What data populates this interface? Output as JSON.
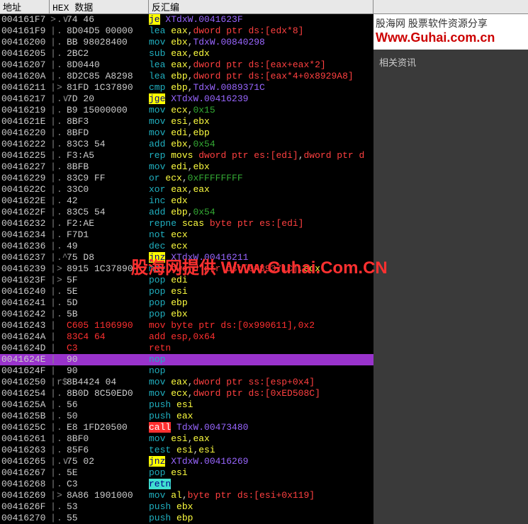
{
  "headers": {
    "addr": "地址",
    "hex": "HEX 数据",
    "disasm": "反汇编"
  },
  "sidebar": {
    "logo_top": "股海网 股票软件资源分享",
    "logo_bot": "Www.Guhai.com.cn",
    "title": "相关资讯"
  },
  "watermark": "股海网提供 Www.Guhai.Com.CN",
  "rows": [
    {
      "addr": "004161F7",
      "pipe": ">",
      "dot": ".∨",
      "hex": "74 46",
      "d": [
        {
          "t": "je",
          "c": "yellow"
        },
        {
          "t": " "
        },
        {
          "t": "XTdxW.0041623F",
          "c": "sym"
        }
      ]
    },
    {
      "addr": "004161F9",
      "pipe": "|",
      "dot": ".",
      "hex": "8D04D5 00000",
      "d": [
        {
          "t": "lea",
          "c": "mn"
        },
        {
          "t": " "
        },
        {
          "t": "eax",
          "c": "reg"
        },
        {
          "t": ",",
          "c": "punc"
        },
        {
          "t": "dword ptr ds:[edx*8]",
          "c": "mem"
        }
      ]
    },
    {
      "addr": "00416200",
      "pipe": "|",
      "dot": ".",
      "hex": "BB 98028400",
      "d": [
        {
          "t": "mov",
          "c": "mn"
        },
        {
          "t": " "
        },
        {
          "t": "ebx",
          "c": "reg"
        },
        {
          "t": ",",
          "c": "punc"
        },
        {
          "t": "TdxW.00840298",
          "c": "sym"
        }
      ]
    },
    {
      "addr": "00416205",
      "pipe": "|",
      "dot": ".",
      "hex": "2BC2",
      "d": [
        {
          "t": "sub",
          "c": "mn"
        },
        {
          "t": " "
        },
        {
          "t": "eax",
          "c": "reg"
        },
        {
          "t": ",",
          "c": "punc"
        },
        {
          "t": "edx",
          "c": "reg"
        }
      ]
    },
    {
      "addr": "00416207",
      "pipe": "|",
      "dot": ".",
      "hex": "8D0440",
      "d": [
        {
          "t": "lea",
          "c": "mn"
        },
        {
          "t": " "
        },
        {
          "t": "eax",
          "c": "reg"
        },
        {
          "t": ",",
          "c": "punc"
        },
        {
          "t": "dword ptr ds:[eax+eax*2]",
          "c": "mem"
        }
      ]
    },
    {
      "addr": "0041620A",
      "pipe": "|",
      "dot": ".",
      "hex": "8D2C85 A8298",
      "d": [
        {
          "t": "lea",
          "c": "mn"
        },
        {
          "t": " "
        },
        {
          "t": "ebp",
          "c": "reg"
        },
        {
          "t": ",",
          "c": "punc"
        },
        {
          "t": "dword ptr ds:[eax*4+0x8929A8]",
          "c": "mem"
        }
      ]
    },
    {
      "addr": "00416211",
      "pipe": "|",
      "dot": ">",
      "hex": "81FD 1C37890",
      "d": [
        {
          "t": "cmp",
          "c": "mn"
        },
        {
          "t": " "
        },
        {
          "t": "ebp",
          "c": "reg"
        },
        {
          "t": ",",
          "c": "punc"
        },
        {
          "t": "TdxW.0089371C",
          "c": "sym"
        }
      ]
    },
    {
      "addr": "00416217",
      "pipe": "|",
      "dot": ".∨",
      "hex": "7D 20",
      "d": [
        {
          "t": "jge",
          "c": "yellow"
        },
        {
          "t": " "
        },
        {
          "t": "XTdxW.00416239",
          "c": "sym"
        }
      ]
    },
    {
      "addr": "00416219",
      "pipe": "|",
      "dot": ".",
      "hex": "B9 15000000",
      "d": [
        {
          "t": "mov",
          "c": "mn"
        },
        {
          "t": " "
        },
        {
          "t": "ecx",
          "c": "reg"
        },
        {
          "t": ",",
          "c": "punc"
        },
        {
          "t": "0x15",
          "c": "num"
        }
      ]
    },
    {
      "addr": "0041621E",
      "pipe": "|",
      "dot": ".",
      "hex": "8BF3",
      "d": [
        {
          "t": "mov",
          "c": "mn"
        },
        {
          "t": " "
        },
        {
          "t": "esi",
          "c": "reg"
        },
        {
          "t": ",",
          "c": "punc"
        },
        {
          "t": "ebx",
          "c": "reg"
        }
      ]
    },
    {
      "addr": "00416220",
      "pipe": "|",
      "dot": ".",
      "hex": "8BFD",
      "d": [
        {
          "t": "mov",
          "c": "mn"
        },
        {
          "t": " "
        },
        {
          "t": "edi",
          "c": "reg"
        },
        {
          "t": ",",
          "c": "punc"
        },
        {
          "t": "ebp",
          "c": "reg"
        }
      ]
    },
    {
      "addr": "00416222",
      "pipe": "|",
      "dot": ".",
      "hex": "83C3 54",
      "d": [
        {
          "t": "add",
          "c": "mn"
        },
        {
          "t": " "
        },
        {
          "t": "ebx",
          "c": "reg"
        },
        {
          "t": ",",
          "c": "punc"
        },
        {
          "t": "0x54",
          "c": "num"
        }
      ]
    },
    {
      "addr": "00416225",
      "pipe": "|",
      "dot": ".",
      "hex": "F3:A5",
      "d": [
        {
          "t": "rep",
          "c": "mn"
        },
        {
          "t": " "
        },
        {
          "t": "movs",
          "c": "reg"
        },
        {
          "t": " "
        },
        {
          "t": "dword ptr es:[edi]",
          "c": "mem"
        },
        {
          "t": ",",
          "c": "punc"
        },
        {
          "t": "dword ptr d",
          "c": "mem"
        }
      ]
    },
    {
      "addr": "00416227",
      "pipe": "|",
      "dot": ".",
      "hex": "8BFB",
      "d": [
        {
          "t": "mov",
          "c": "mn"
        },
        {
          "t": " "
        },
        {
          "t": "edi",
          "c": "reg"
        },
        {
          "t": ",",
          "c": "punc"
        },
        {
          "t": "ebx",
          "c": "reg"
        }
      ]
    },
    {
      "addr": "00416229",
      "pipe": "|",
      "dot": ".",
      "hex": "83C9 FF",
      "d": [
        {
          "t": "or",
          "c": "mn"
        },
        {
          "t": " "
        },
        {
          "t": "ecx",
          "c": "reg"
        },
        {
          "t": ",",
          "c": "punc"
        },
        {
          "t": "0xFFFFFFFF",
          "c": "num"
        }
      ]
    },
    {
      "addr": "0041622C",
      "pipe": "|",
      "dot": ".",
      "hex": "33C0",
      "d": [
        {
          "t": "xor",
          "c": "mn"
        },
        {
          "t": " "
        },
        {
          "t": "eax",
          "c": "reg"
        },
        {
          "t": ",",
          "c": "punc"
        },
        {
          "t": "eax",
          "c": "reg"
        }
      ]
    },
    {
      "addr": "0041622E",
      "pipe": "|",
      "dot": ".",
      "hex": "42",
      "d": [
        {
          "t": "inc",
          "c": "mn"
        },
        {
          "t": " "
        },
        {
          "t": "edx",
          "c": "reg"
        }
      ]
    },
    {
      "addr": "0041622F",
      "pipe": "|",
      "dot": ".",
      "hex": "83C5 54",
      "d": [
        {
          "t": "add",
          "c": "mn"
        },
        {
          "t": " "
        },
        {
          "t": "ebp",
          "c": "reg"
        },
        {
          "t": ",",
          "c": "punc"
        },
        {
          "t": "0x54",
          "c": "num"
        }
      ]
    },
    {
      "addr": "00416232",
      "pipe": "|",
      "dot": ".",
      "hex": "F2:AE",
      "d": [
        {
          "t": "repne",
          "c": "mn"
        },
        {
          "t": " "
        },
        {
          "t": "scas",
          "c": "reg"
        },
        {
          "t": " "
        },
        {
          "t": "byte ptr es:[edi]",
          "c": "mem"
        }
      ]
    },
    {
      "addr": "00416234",
      "pipe": "|",
      "dot": ".",
      "hex": "F7D1",
      "d": [
        {
          "t": "not",
          "c": "mn"
        },
        {
          "t": " "
        },
        {
          "t": "ecx",
          "c": "reg"
        }
      ]
    },
    {
      "addr": "00416236",
      "pipe": "|",
      "dot": ".",
      "hex": "49",
      "d": [
        {
          "t": "dec",
          "c": "mn"
        },
        {
          "t": " "
        },
        {
          "t": "ecx",
          "c": "reg"
        }
      ]
    },
    {
      "addr": "00416237",
      "pipe": "|",
      "dot": ".^",
      "hex": "75 D8",
      "d": [
        {
          "t": "jnz",
          "c": "yellow"
        },
        {
          "t": " "
        },
        {
          "t": "XTdxW.00416211",
          "c": "sym"
        }
      ]
    },
    {
      "addr": "00416239",
      "pipe": "|",
      "dot": ">",
      "hex": "8915 1C37890",
      "d": [
        {
          "t": "mov",
          "c": "mn"
        },
        {
          "t": " "
        },
        {
          "t": "dword ptr ds:[0x89371C]",
          "c": "mem"
        },
        {
          "t": ",",
          "c": "punc"
        },
        {
          "t": "edx",
          "c": "reg"
        }
      ]
    },
    {
      "addr": "0041623F",
      "pipe": "|",
      "dot": ">",
      "hex": "5F",
      "d": [
        {
          "t": "pop",
          "c": "mn"
        },
        {
          "t": " "
        },
        {
          "t": "edi",
          "c": "reg"
        }
      ]
    },
    {
      "addr": "00416240",
      "pipe": "|",
      "dot": ".",
      "hex": "5E",
      "d": [
        {
          "t": "pop",
          "c": "mn"
        },
        {
          "t": " "
        },
        {
          "t": "esi",
          "c": "reg"
        }
      ]
    },
    {
      "addr": "00416241",
      "pipe": "|",
      "dot": ".",
      "hex": "5D",
      "d": [
        {
          "t": "pop",
          "c": "mn"
        },
        {
          "t": " "
        },
        {
          "t": "ebp",
          "c": "reg"
        }
      ]
    },
    {
      "addr": "00416242",
      "pipe": "|",
      "dot": ".",
      "hex": "5B",
      "d": [
        {
          "t": "pop",
          "c": "mn"
        },
        {
          "t": " "
        },
        {
          "t": "ebx",
          "c": "reg"
        }
      ]
    },
    {
      "addr": "00416243",
      "pipe": "|",
      "dot": "",
      "hex": "C605 1106990",
      "hred": true,
      "dred": true,
      "d": [
        {
          "t": "mov byte ptr ds:[0x990611],0x2"
        }
      ]
    },
    {
      "addr": "0041624A",
      "pipe": "|",
      "dot": "",
      "hex": "83C4 64",
      "hred": true,
      "dred": true,
      "d": [
        {
          "t": "add esp,0x64"
        }
      ]
    },
    {
      "addr": "0041624D",
      "pipe": "|",
      "dot": "",
      "hex": "C3",
      "hred": true,
      "dred": true,
      "d": [
        {
          "t": "retn"
        }
      ]
    },
    {
      "addr": "0041624E",
      "pipe": "|",
      "dot": "",
      "hex": "90",
      "d": [
        {
          "t": "nop",
          "c": "mn"
        }
      ],
      "hilite": true
    },
    {
      "addr": "0041624F",
      "pipe": "|",
      "dot": "",
      "hex": "90",
      "d": [
        {
          "t": "nop",
          "c": "mn"
        }
      ]
    },
    {
      "addr": "00416250",
      "pipe": "|",
      "dot": "r$",
      "hex": "8B4424 04",
      "d": [
        {
          "t": "mov",
          "c": "mn"
        },
        {
          "t": " "
        },
        {
          "t": "eax",
          "c": "reg"
        },
        {
          "t": ",",
          "c": "punc"
        },
        {
          "t": "dword ptr ss:[esp+0x4]",
          "c": "mem"
        }
      ]
    },
    {
      "addr": "00416254",
      "pipe": "|",
      "dot": ".",
      "hex": "8B0D 8C50ED0",
      "d": [
        {
          "t": "mov",
          "c": "mn"
        },
        {
          "t": " "
        },
        {
          "t": "ecx",
          "c": "reg"
        },
        {
          "t": ",",
          "c": "punc"
        },
        {
          "t": "dword ptr ds:[0xED508C]",
          "c": "mem"
        }
      ]
    },
    {
      "addr": "0041625A",
      "pipe": "|",
      "dot": ".",
      "hex": "56",
      "d": [
        {
          "t": "push",
          "c": "mn"
        },
        {
          "t": " "
        },
        {
          "t": "esi",
          "c": "reg"
        }
      ]
    },
    {
      "addr": "0041625B",
      "pipe": "|",
      "dot": ".",
      "hex": "50",
      "d": [
        {
          "t": "push",
          "c": "mn"
        },
        {
          "t": " "
        },
        {
          "t": "eax",
          "c": "reg"
        }
      ]
    },
    {
      "addr": "0041625C",
      "pipe": "|",
      "dot": ".",
      "hex": "E8 1FD20500",
      "d": [
        {
          "t": "call",
          "c": "red"
        },
        {
          "t": " "
        },
        {
          "t": "TdxW.00473480",
          "c": "sym"
        }
      ]
    },
    {
      "addr": "00416261",
      "pipe": "|",
      "dot": ".",
      "hex": "8BF0",
      "d": [
        {
          "t": "mov",
          "c": "mn"
        },
        {
          "t": " "
        },
        {
          "t": "esi",
          "c": "reg"
        },
        {
          "t": ",",
          "c": "punc"
        },
        {
          "t": "eax",
          "c": "reg"
        }
      ]
    },
    {
      "addr": "00416263",
      "pipe": "|",
      "dot": ".",
      "hex": "85F6",
      "d": [
        {
          "t": "test",
          "c": "mn"
        },
        {
          "t": " "
        },
        {
          "t": "esi",
          "c": "reg"
        },
        {
          "t": ",",
          "c": "punc"
        },
        {
          "t": "esi",
          "c": "reg"
        }
      ]
    },
    {
      "addr": "00416265",
      "pipe": "|",
      "dot": ".∨",
      "hex": "75 02",
      "d": [
        {
          "t": "jnz",
          "c": "yellow"
        },
        {
          "t": " "
        },
        {
          "t": "XTdxW.00416269",
          "c": "sym"
        }
      ]
    },
    {
      "addr": "00416267",
      "pipe": "|",
      "dot": ".",
      "hex": "5E",
      "d": [
        {
          "t": "pop",
          "c": "mn"
        },
        {
          "t": " "
        },
        {
          "t": "esi",
          "c": "reg"
        }
      ]
    },
    {
      "addr": "00416268",
      "pipe": "|",
      "dot": ".",
      "hex": "C3",
      "d": [
        {
          "t": "retn",
          "c": "cyan"
        }
      ]
    },
    {
      "addr": "00416269",
      "pipe": "|",
      "dot": ">",
      "hex": "8A86 1901000",
      "d": [
        {
          "t": "mov",
          "c": "mn"
        },
        {
          "t": " "
        },
        {
          "t": "al",
          "c": "reg"
        },
        {
          "t": ",",
          "c": "punc"
        },
        {
          "t": "byte ptr ds:[esi+0x119]",
          "c": "mem"
        }
      ]
    },
    {
      "addr": "0041626F",
      "pipe": "|",
      "dot": ".",
      "hex": "53",
      "d": [
        {
          "t": "push",
          "c": "mn"
        },
        {
          "t": " "
        },
        {
          "t": "ebx",
          "c": "reg"
        }
      ]
    },
    {
      "addr": "00416270",
      "pipe": "|",
      "dot": ".",
      "hex": "55",
      "d": [
        {
          "t": "push",
          "c": "mn"
        },
        {
          "t": " "
        },
        {
          "t": "ebp",
          "c": "reg"
        }
      ]
    }
  ]
}
